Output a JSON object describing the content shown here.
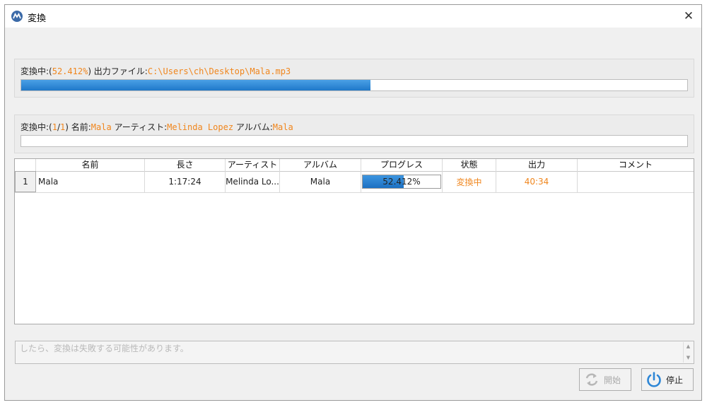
{
  "window": {
    "title": "変換",
    "close_glyph": "✕"
  },
  "overall": {
    "prefix": "変換中:(",
    "percent": "52.412%",
    "middle": ") 出力ファイル:",
    "output_path": "C:\\Users\\ch\\Desktop\\Mala.mp3",
    "progress": 0.52412
  },
  "current": {
    "prefix": "変換中:(",
    "index": "1",
    "slash": "/",
    "total": "1",
    "name_label": ") 名前:",
    "name": "Mala",
    "artist_label": " アーティスト:",
    "artist": "Melinda Lopez",
    "album_label": " アルバム:",
    "album": "Mala",
    "progress": 0
  },
  "table": {
    "headers": [
      "名前",
      "長さ",
      "アーティスト",
      "アルバム",
      "プログレス",
      "状態",
      "出力",
      "コメント"
    ],
    "rows": [
      {
        "num": "1",
        "name": "Mala",
        "length": "1:17:24",
        "artist": "Melinda Lo...",
        "album": "Mala",
        "progress_text": "52.412%",
        "progress": 0.52412,
        "status": "変換中",
        "output": "40:34",
        "comment": ""
      }
    ]
  },
  "log": {
    "text": "したら、変換は失敗する可能性があります。"
  },
  "buttons": {
    "start": "開始",
    "stop": "停止"
  },
  "colors": {
    "accent": "#f0861d",
    "progress": "#1f78c9"
  }
}
